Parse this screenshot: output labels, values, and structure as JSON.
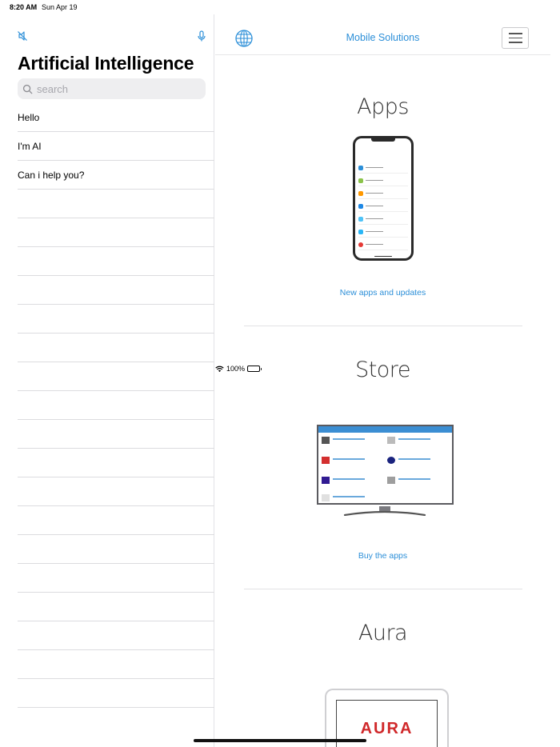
{
  "status_bar": {
    "time": "8:20 AM",
    "date": "Sun Apr 19",
    "battery": "100%"
  },
  "sidebar": {
    "title": "Artificial Intelligence",
    "search_placeholder": "search",
    "items": [
      {
        "label": "Hello"
      },
      {
        "label": "I'm AI"
      },
      {
        "label": "Can i help you?"
      }
    ],
    "empty_rows": 18
  },
  "navbar": {
    "title": "Mobile Solutions"
  },
  "sections": [
    {
      "title": "Apps",
      "link": "New apps and updates"
    },
    {
      "title": "Store",
      "link": "Buy the apps"
    },
    {
      "title": "Aura"
    }
  ],
  "tablet_logo_text": "AURA",
  "colors": {
    "accent": "#2c8fd8",
    "divider": "#dcdcdf",
    "aura_red": "#d0282a"
  }
}
